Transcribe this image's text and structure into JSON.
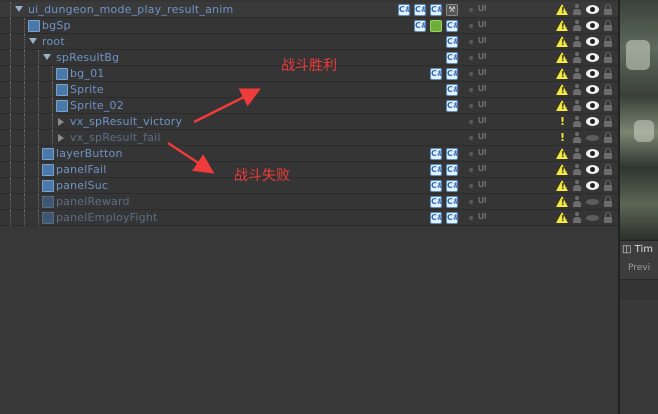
{
  "hierarchy": {
    "rows": [
      {
        "name": "ui_dungeon_mode_play_result_anim",
        "layer": "UI",
        "warn": "triangle",
        "visible": true
      },
      {
        "name": "bgSp",
        "layer": "UI",
        "warn": "triangle",
        "visible": true
      },
      {
        "name": "root",
        "layer": "UI",
        "warn": "triangle",
        "visible": true
      },
      {
        "name": "spResultBg",
        "layer": "UI",
        "warn": "triangle",
        "visible": true
      },
      {
        "name": "bg_01",
        "layer": "UI",
        "warn": "triangle",
        "visible": true
      },
      {
        "name": "Sprite",
        "layer": "UI",
        "warn": "triangle",
        "visible": true
      },
      {
        "name": "Sprite_02",
        "layer": "UI",
        "warn": "triangle",
        "visible": true
      },
      {
        "name": "vx_spResult_victory",
        "layer": "UI",
        "warn": "exclamation",
        "visible": true
      },
      {
        "name": "vx_spResult_fail",
        "layer": "UI",
        "warn": "exclamation",
        "visible": false
      },
      {
        "name": "layerButton",
        "layer": "UI",
        "warn": "triangle",
        "visible": true
      },
      {
        "name": "panelFail",
        "layer": "UI",
        "warn": "triangle",
        "visible": true
      },
      {
        "name": "panelSuc",
        "layer": "UI",
        "warn": "triangle",
        "visible": true
      },
      {
        "name": "panelReward",
        "layer": "UI",
        "warn": "triangle",
        "visible": false
      },
      {
        "name": "panelEmployFight",
        "layer": "UI",
        "warn": "triangle",
        "visible": false
      }
    ]
  },
  "annotations": {
    "victory_label": "战斗胜利",
    "fail_label": "战斗失败",
    "color": "#ef3b3b"
  },
  "timeline": {
    "tab_label": "Tim",
    "preview_label": "Previ"
  },
  "colors": {
    "name_active": "#6f93c8",
    "name_inactive": "#5c6e86",
    "warning": "#f4e73f"
  }
}
